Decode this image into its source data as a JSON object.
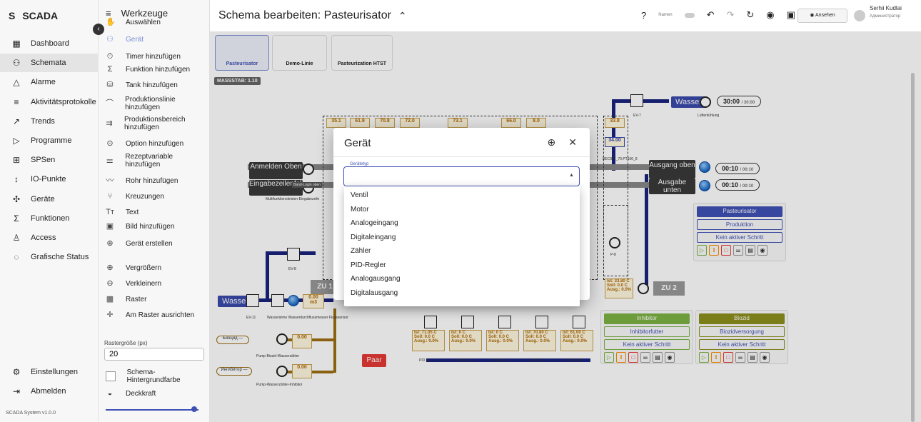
{
  "app": {
    "logo_letter": "S",
    "name": "SCADA",
    "version": "SCADA System v1.0.0"
  },
  "nav": {
    "items": [
      {
        "icon": "dashboard-icon",
        "glyph": "▦",
        "label": "Dashboard"
      },
      {
        "icon": "schema-icon",
        "glyph": "⚇",
        "label": "Schemata"
      },
      {
        "icon": "bell-icon",
        "glyph": "△",
        "label": "Alarme"
      },
      {
        "icon": "list-icon",
        "glyph": "≡",
        "label": "Aktivitätsprotokolle"
      },
      {
        "icon": "trend-icon",
        "glyph": "↗",
        "label": "Trends"
      },
      {
        "icon": "play-icon",
        "glyph": "▷",
        "label": "Programme"
      },
      {
        "icon": "plc-icon",
        "glyph": "⊞",
        "label": "SPSen"
      },
      {
        "icon": "io-icon",
        "glyph": "↕",
        "label": "IO-Punkte"
      },
      {
        "icon": "device-icon",
        "glyph": "✣",
        "label": "Geräte"
      },
      {
        "icon": "sigma-icon",
        "glyph": "Σ",
        "label": "Funktionen"
      },
      {
        "icon": "access-icon",
        "glyph": "♙",
        "label": "Access"
      },
      {
        "icon": "status-icon",
        "glyph": "◌",
        "label": "Grafische Status"
      }
    ],
    "settings": "Einstellungen",
    "logout": "Abmelden"
  },
  "tools": {
    "title": "Werkzeuge",
    "items": [
      {
        "glyph": "✋",
        "label": "Auswählen"
      },
      {
        "glyph": "⚇",
        "label": "Gerät"
      },
      {
        "glyph": "⏱",
        "label": "Timer hinzufügen"
      },
      {
        "glyph": "Σ",
        "label": "Funktion hinzufügen"
      },
      {
        "glyph": "⛁",
        "label": "Tank hinzufügen"
      },
      {
        "glyph": "⌒",
        "label": "Produktionslinie hinzufügen"
      },
      {
        "glyph": "⇉",
        "label": "Produktionsbereich hinzufügen"
      },
      {
        "glyph": "⊙",
        "label": "Option hinzufügen"
      },
      {
        "glyph": "⚌",
        "label": "Rezeptvariable hinzufügen"
      },
      {
        "glyph": "〰",
        "label": "Rohr hinzufügen"
      },
      {
        "glyph": "⑂",
        "label": "Kreuzungen"
      },
      {
        "glyph": "Tт",
        "label": "Text"
      },
      {
        "glyph": "▣",
        "label": "Bild hinzufügen"
      },
      {
        "glyph": "⊕",
        "label": "Gerät erstellen"
      },
      {
        "glyph": "⊕",
        "label": "Vergrößern"
      },
      {
        "glyph": "⊖",
        "label": "Verkleinern"
      },
      {
        "glyph": "▦",
        "label": "Raster"
      },
      {
        "glyph": "✛",
        "label": "Am Raster ausrichten"
      }
    ],
    "grid_label": "Rastergröße (px)",
    "grid_value": "20",
    "bg_label": "Schema-Hintergrundfarbe",
    "opacity_label": "Deckkraft",
    "opacity_fraction": 0.95
  },
  "header": {
    "title": "Schema bearbeiten: Pasteurisator",
    "names_label": "Namen",
    "view_button": "Ansehen",
    "user_name": "Serhii Kudlai",
    "user_role": "Администратор"
  },
  "tabs": [
    "Pasteurisator",
    "Demo-Linie",
    "Pasteurization HTST"
  ],
  "canvas": {
    "scale": "MASSSTAB: 1.10",
    "water1": "Wasser",
    "timer1": "30:00",
    "timer1_max": "/ 30:00",
    "ev7": "EV-7",
    "luefter": "Lüfterkühlung",
    "tags": [
      "35.1",
      "61.9",
      "70.8",
      "72.0",
      "73.1",
      "66.0",
      "8.0",
      "33.8"
    ],
    "tag_small": "34.00",
    "anmelden": "Anmelden Oben",
    "eingabe": "Eingabezeilenfolge",
    "ausgang_oben": "Ausgang oben",
    "ausgabe_unten": "Ausgabe unten",
    "timer2": "00:10",
    "timer2_max": "/ 00:10",
    "timer3": "00:10",
    "timer3_max": "/ 00:10",
    "recipe": "RECIPE_70.PT100_8",
    "band_login": "Band-Login oben",
    "multi": "Multifunktionsleisten-Eingabezeile",
    "zu1": "ZU 1",
    "zu2": "ZU 2",
    "p8": "P-8",
    "ev8": "EV-8",
    "ev11": "EV-11",
    "water2": "Wasser",
    "flow": "0.00",
    "flow_unit": "m3",
    "wasserzaehler": "Wasserärme Wasserdurchflussmesser Flusssensor",
    "bioc": "Биоцид",
    "inhib": "Ингибитор",
    "pump_bioc": "Pump Biozid-Wasserzähler",
    "pump_inhib": "Pump-Wasserzähler-Inhibitor",
    "val_bioc": "0.00",
    "val_inhib": "0.00",
    "paar": "Paar",
    "pid_labels": [
      "PID EV-1",
      "PID EV-2",
      "PID EV-3",
      "PID EV-4",
      "PID EV-5"
    ],
    "pid_ist": [
      "71.05 C",
      "0 C",
      "0 C",
      "70.80 C",
      "61.00 C"
    ],
    "pid_right": {
      "ist": "33.80 C",
      "soll": "0.0 C",
      "ausg": "0.0%"
    },
    "pasteur_panel": {
      "title": "Pasteurisator",
      "mode": "Produktion",
      "step": "Kein aktiver Schritt"
    },
    "inhib_panel": {
      "title": "Inhibitor",
      "sub": "Inhibitorfutter",
      "step": "Kein aktiver Schritt"
    },
    "bioz_panel": {
      "title": "Biozid",
      "sub": "Biozidversorgung",
      "step": "Kein aktiver Schritt"
    }
  },
  "dialog": {
    "title": "Gerät",
    "field_label": "Gerätetyp",
    "options": [
      "Ventil",
      "Motor",
      "Analogeingang",
      "Digitaleingang",
      "Zähler",
      "PID-Regler",
      "Analogausgang",
      "Digitalausgang"
    ]
  },
  "colors": {
    "accent": "#3f51b5",
    "pipe": "#1a237e",
    "green": "#7cb342",
    "olive": "#8d8f1c"
  }
}
